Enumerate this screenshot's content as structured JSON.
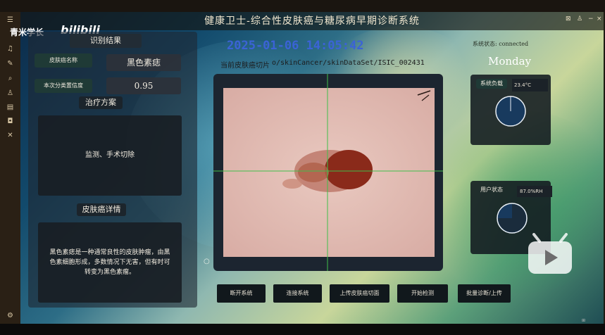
{
  "window": {
    "title": "健康卫士-综合性皮肤癌与糖尿病早期诊断系统",
    "controls": [
      "⊠",
      "♙",
      "−"
    ]
  },
  "watermark": {
    "channel": "青米学长",
    "logo_text": "bilibili"
  },
  "left_panel": {
    "header": "识别结果",
    "name_label": "皮肤癌名称",
    "name_value": "黑色素痣",
    "conf_label": "本次分类置信度",
    "conf_value": "0.95",
    "plan_header": "治疗方案",
    "plan_text": "监测、手术切除",
    "detail_header": "皮肤癌详情",
    "detail_text": "黑色素痣是一种通常良性的皮肤肿瘤，由黑色素细胞形成，多数情况下无害，但有时可转变为黑色素瘤。"
  },
  "center": {
    "datetime": "2025-01-06  14:05:42",
    "slice_label": "当前皮肤癌切片",
    "slice_path": "o/skinCancer/skinDataSet/ISIC_002431"
  },
  "right_panel": {
    "system_status": "系统状态: connected",
    "weekday": "Monday",
    "load_label": "系统负载",
    "load_value": "23.4°C",
    "user_label": "用户状态",
    "user_value": "87.0%RH",
    "gauges": [
      {
        "name": "system-load-gauge",
        "fraction": 0.0
      },
      {
        "name": "user-status-gauge",
        "fraction": 0.75
      }
    ]
  },
  "buttons": [
    "断开系统",
    "连接系统",
    "上传皮肤癌切面",
    "开始检测",
    "批量诊断/上传"
  ],
  "colors": {
    "accent_blue": "#3b63d6",
    "panel_dark": "#1e2834",
    "crosshair": "#3fbf4a",
    "lesion": "#8a2a1a"
  }
}
